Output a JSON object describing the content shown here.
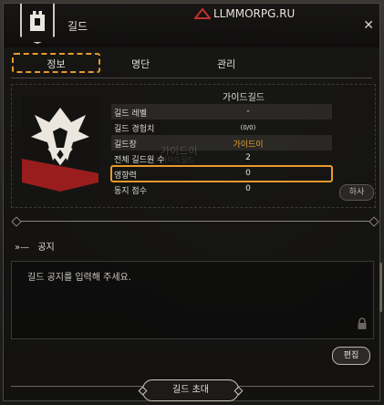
{
  "window": {
    "title": "길드",
    "close_glyph": "✕",
    "site_label": "LLMMORPG.RU"
  },
  "tabs": [
    {
      "label": "정보",
      "active": true
    },
    {
      "label": "명단",
      "active": false
    },
    {
      "label": "관리",
      "active": false
    }
  ],
  "guild": {
    "name": "가이드길드",
    "rows": [
      {
        "label": "길드 레벨",
        "value": "-"
      },
      {
        "label": "길드 경험치",
        "value": "(0/0)"
      },
      {
        "label": "길드장",
        "value": "가이드이"
      },
      {
        "label": "전체 길드원 수",
        "value": "2"
      },
      {
        "label": "영향력",
        "value": "0"
      },
      {
        "label": "동지 점수",
        "value": "0"
      }
    ],
    "ghost_name": "가이드이",
    "ghost_sub": "가이드길드",
    "small_button": "하사"
  },
  "notice": {
    "heading": "공지",
    "arrows": "»—",
    "placeholder": "길드 공지를 입력해 주세요.",
    "edit_label": "편집"
  },
  "footer": {
    "invite_label": "길드 초대"
  },
  "colors": {
    "accent": "#e89a2a",
    "gold_text": "#e8a030",
    "crest_red": "#b02020"
  },
  "icons": [
    "emblem-icon",
    "close-icon",
    "lock-icon",
    "guild-crest-icon",
    "site-logo-icon"
  ]
}
